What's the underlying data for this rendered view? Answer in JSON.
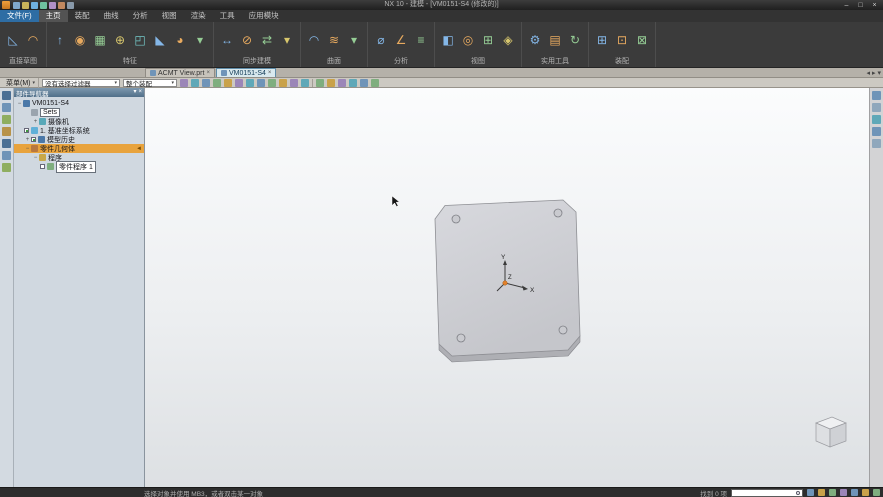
{
  "titlebar": {
    "title": "NX 10 - 建模 - [VM0151-S4 (修改的)]",
    "controls": {
      "minimize": "–",
      "maximize": "□",
      "close": "×"
    }
  },
  "menubar": {
    "tabs": [
      {
        "label": "文件(F)"
      },
      {
        "label": "主页"
      },
      {
        "label": "装配"
      },
      {
        "label": "曲线"
      },
      {
        "label": "分析"
      },
      {
        "label": "视图"
      },
      {
        "label": "渲染"
      },
      {
        "label": "工具"
      },
      {
        "label": "应用模块"
      }
    ]
  },
  "ribbon": {
    "groups": [
      {
        "label": "直接草图",
        "items": [
          {
            "name": "sketch-icon",
            "glyph": "◺"
          },
          {
            "name": "sketch-curve-icon",
            "glyph": "◠"
          }
        ]
      },
      {
        "label": "特征",
        "items": [
          {
            "name": "extrude-icon",
            "glyph": "↑"
          },
          {
            "name": "hole-icon",
            "glyph": "◉"
          },
          {
            "name": "pattern-feature-icon",
            "glyph": "▦"
          },
          {
            "name": "unite-icon",
            "glyph": "⊕"
          },
          {
            "name": "shell-icon",
            "glyph": "◰"
          },
          {
            "name": "chamfer-icon",
            "glyph": "◣"
          },
          {
            "name": "edge-blend-icon",
            "glyph": "◕"
          },
          {
            "name": "feature-more-icon",
            "glyph": "▾"
          }
        ]
      },
      {
        "label": "同步建模",
        "items": [
          {
            "name": "move-face-icon",
            "glyph": "↔"
          },
          {
            "name": "delete-face-icon",
            "glyph": "⊘"
          },
          {
            "name": "replace-face-icon",
            "glyph": "⇄"
          },
          {
            "name": "synchronous-more-icon",
            "glyph": "▾"
          }
        ]
      },
      {
        "label": "曲面",
        "items": [
          {
            "name": "ruled-surface-icon",
            "glyph": "◠"
          },
          {
            "name": "through-curves-icon",
            "glyph": "≋"
          },
          {
            "name": "surface-more-icon",
            "glyph": "▾"
          }
        ]
      },
      {
        "label": "分析",
        "items": [
          {
            "name": "measure-distance-icon",
            "glyph": "⌀"
          },
          {
            "name": "measure-angle-icon",
            "glyph": "∠"
          },
          {
            "name": "geometric-properties-icon",
            "glyph": "≡"
          }
        ]
      },
      {
        "label": "视图",
        "items": [
          {
            "name": "window-icon",
            "glyph": "◧"
          },
          {
            "name": "show-hide-icon",
            "glyph": "◎"
          },
          {
            "name": "layout-icon",
            "glyph": "⊞"
          },
          {
            "name": "render-style-icon",
            "glyph": "◈"
          }
        ]
      },
      {
        "label": "实用工具",
        "items": [
          {
            "name": "settings-icon",
            "glyph": "⚙"
          },
          {
            "name": "layer-settings-icon",
            "glyph": "▤"
          },
          {
            "name": "update-icon",
            "glyph": "↻"
          }
        ]
      },
      {
        "label": "装配",
        "items": [
          {
            "name": "add-component-icon",
            "glyph": "⊞"
          },
          {
            "name": "assembly-constraints-icon",
            "glyph": "⊡"
          },
          {
            "name": "move-component-icon",
            "glyph": "⊠"
          }
        ]
      }
    ]
  },
  "doctabs": {
    "tabs": [
      {
        "label": "ACMT View.prt"
      },
      {
        "label": "VM0151-S4"
      }
    ],
    "close_glyph": "×",
    "scroll_left": "◂",
    "scroll_right": "▸",
    "more": "▾"
  },
  "selbar": {
    "menu_label": "菜单(M)",
    "filter_value": "没有选择过滤器",
    "scope_value": "整个装配"
  },
  "sidebar": {
    "header": "部件导航器",
    "menu_glyph": "▾",
    "close_glyph": "×",
    "selected_marker": "◄",
    "rows": [
      {
        "label": "VM0151-S4",
        "exp": "−"
      },
      {
        "label": "Sets",
        "exp": ""
      },
      {
        "label": "摄像机",
        "exp": "+"
      },
      {
        "label": "1. 基准坐标系统",
        "exp": ""
      },
      {
        "label": "模型历史",
        "exp": "+"
      },
      {
        "label": "零件几何体",
        "exp": "−"
      },
      {
        "label": "程序",
        "exp": "−"
      },
      {
        "label": "零件程序 1",
        "exp": ""
      }
    ]
  },
  "canvas": {
    "axis_labels": {
      "x": "X",
      "y": "Y",
      "z": "Z"
    }
  },
  "statusbar": {
    "hint": "选择对象并使用 MB3，或者双击某一对象",
    "found": "找到 0 项"
  },
  "colors": {
    "selection_orange": "#e8a33d",
    "part_gray": "#d3d4d9",
    "ribbon_dark": "#3b3b3b",
    "active_tab_blue": "#d9e9ee"
  }
}
